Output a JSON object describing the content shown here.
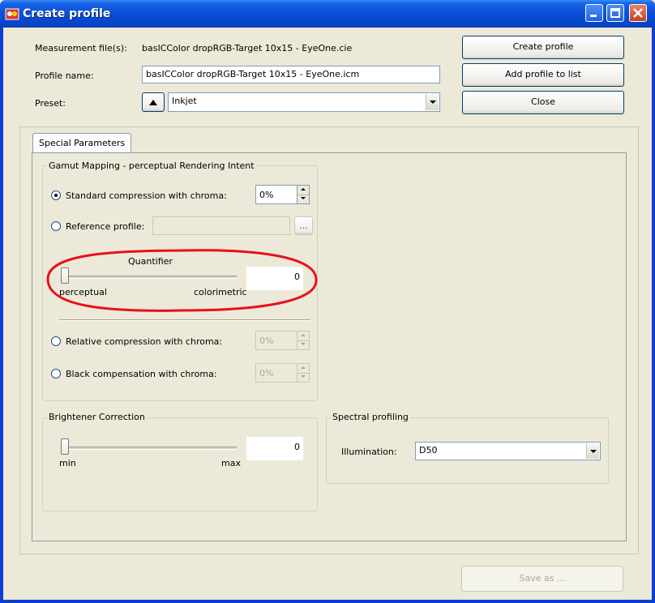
{
  "window": {
    "title": "Create profile"
  },
  "form": {
    "measurement_label": "Measurement file(s):",
    "measurement_value": "basICColor dropRGB-Target 10x15 - EyeOne.cie",
    "profile_name_label": "Profile name:",
    "profile_name_value": "basICColor dropRGB-Target 10x15 - EyeOne.icm",
    "preset_label": "Preset:",
    "preset_value": "Inkjet"
  },
  "buttons": {
    "create_profile": "Create profile",
    "add_profile_to_list": "Add profile to list",
    "close": "Close",
    "browse": "...",
    "save_as": "Save as ..."
  },
  "tabs": [
    {
      "label": "Special Parameters",
      "active": true
    }
  ],
  "gamut_mapping": {
    "legend": "Gamut Mapping - perceptual Rendering Intent",
    "standard_label": "Standard compression with chroma:",
    "standard_value": "0%",
    "standard_checked": true,
    "reference_label": "Reference profile:",
    "reference_value": "",
    "quantifier": {
      "title": "Quantifier",
      "min_label": "perceptual",
      "max_label": "colorimetric",
      "value": "0",
      "position": 0
    },
    "relative_label": "Relative compression with chroma:",
    "relative_value": "0%",
    "black_label": "Black compensation with chroma:",
    "black_value": "0%"
  },
  "brightener": {
    "legend": "Brightener Correction",
    "min_label": "min",
    "max_label": "max",
    "value": "0",
    "position": 0
  },
  "spectral": {
    "legend": "Spectral profiling",
    "illumination_label": "Illumination:",
    "illumination_value": "D50"
  },
  "colors": {
    "annotation": "#e8101c",
    "titlebar": "#0a4fd6"
  }
}
